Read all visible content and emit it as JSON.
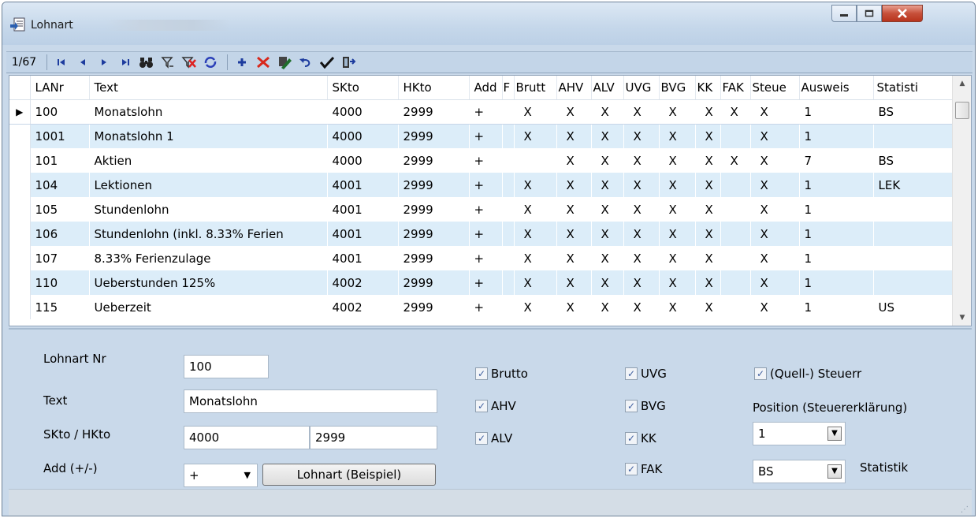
{
  "window": {
    "title": "Lohnart"
  },
  "toolbar": {
    "counter": "1/67",
    "buttons": [
      "first-icon",
      "prev-icon",
      "next-icon",
      "last-icon",
      "binoculars-icon",
      "filter-icon",
      "filter-clear-icon",
      "refresh-icon",
      "add-icon",
      "delete-icon",
      "edit-icon",
      "undo-icon",
      "check-icon",
      "exit-icon"
    ]
  },
  "grid": {
    "columns": [
      "LANr",
      "Text",
      "SKto",
      "HKto",
      "Add",
      "F",
      "Brutt",
      "AHV",
      "ALV",
      "UVG",
      "BVG",
      "KK",
      "FAK",
      "Steue",
      "Ausweis",
      "Statisti"
    ],
    "rows": [
      [
        "100",
        "Monatslohn",
        "4000",
        "2999",
        "+",
        "",
        "X",
        "X",
        "X",
        "X",
        "X",
        "X",
        "X",
        "X",
        "1",
        "BS"
      ],
      [
        "1001",
        "Monatslohn 1",
        "4000",
        "2999",
        "+",
        "",
        "X",
        "X",
        "X",
        "X",
        "X",
        "X",
        "",
        "X",
        "1",
        ""
      ],
      [
        "101",
        "Aktien",
        "4000",
        "2999",
        "+",
        "",
        "",
        "X",
        "X",
        "X",
        "X",
        "X",
        "X",
        "X",
        "7",
        "BS"
      ],
      [
        "104",
        "Lektionen",
        "4001",
        "2999",
        "+",
        "",
        "X",
        "X",
        "X",
        "X",
        "X",
        "X",
        "",
        "X",
        "1",
        "LEK"
      ],
      [
        "105",
        "Stundenlohn",
        "4001",
        "2999",
        "+",
        "",
        "X",
        "X",
        "X",
        "X",
        "X",
        "X",
        "",
        "X",
        "1",
        ""
      ],
      [
        "106",
        "Stundenlohn (inkl. 8.33% Ferien",
        "4001",
        "2999",
        "+",
        "",
        "X",
        "X",
        "X",
        "X",
        "X",
        "X",
        "",
        "X",
        "1",
        ""
      ],
      [
        "107",
        "8.33% Ferienzulage",
        "4001",
        "2999",
        "+",
        "",
        "X",
        "X",
        "X",
        "X",
        "X",
        "X",
        "",
        "X",
        "1",
        ""
      ],
      [
        "110",
        "Ueberstunden 125%",
        "4002",
        "2999",
        "+",
        "",
        "X",
        "X",
        "X",
        "X",
        "X",
        "X",
        "",
        "X",
        "1",
        ""
      ],
      [
        "115",
        "Ueberzeit",
        "4002",
        "2999",
        "+",
        "",
        "X",
        "X",
        "X",
        "X",
        "X",
        "X",
        "",
        "X",
        "1",
        "US"
      ]
    ]
  },
  "form": {
    "lohnart_nr_label": "Lohnart Nr",
    "lohnart_nr_value": "100",
    "text_label": "Text",
    "text_value": "Monatslohn",
    "skto_hkto_label": "SKto / HKto",
    "skto_value": "4000",
    "hkto_value": "2999",
    "add_label": "Add (+/-)",
    "add_value": "+",
    "example_button": "Lohnart (Beispiel)",
    "brutto": "Brutto",
    "ahv": "AHV",
    "alv": "ALV",
    "uvg": "UVG",
    "bvg": "BVG",
    "kk": "KK",
    "fak": "FAK",
    "quellsteuer": "(Quell-) Steuerr",
    "position_label": "Position (Steuererklärung)",
    "position_value": "1",
    "statistik_value": "BS",
    "statistik_label": "Statistik"
  }
}
